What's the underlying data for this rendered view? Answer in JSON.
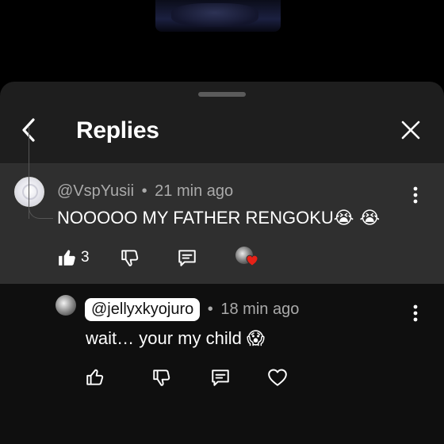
{
  "screen": {
    "title": "Replies",
    "back_icon": "chevron-left-icon",
    "close_icon": "close-icon"
  },
  "parent_comment": {
    "author": "@VspYusii",
    "separator": "•",
    "time": "21 min ago",
    "text": "NOOOOO MY FATHER RENGOKU",
    "text_emojis": "😭 😭",
    "like_count": "3",
    "creator_heart_badge": true
  },
  "reply": {
    "mention": "@jellyxkyojuro",
    "separator": "•",
    "time": "18 min ago",
    "text": "wait… your my child",
    "emoji": "😱"
  },
  "colors": {
    "sheet_bg": "#1e1e1e",
    "parent_highlight_bg": "#2f2f2f",
    "reply_bg": "#0f0f0f",
    "meta_text": "#aaaaaa",
    "heart_red": "#e62117"
  }
}
